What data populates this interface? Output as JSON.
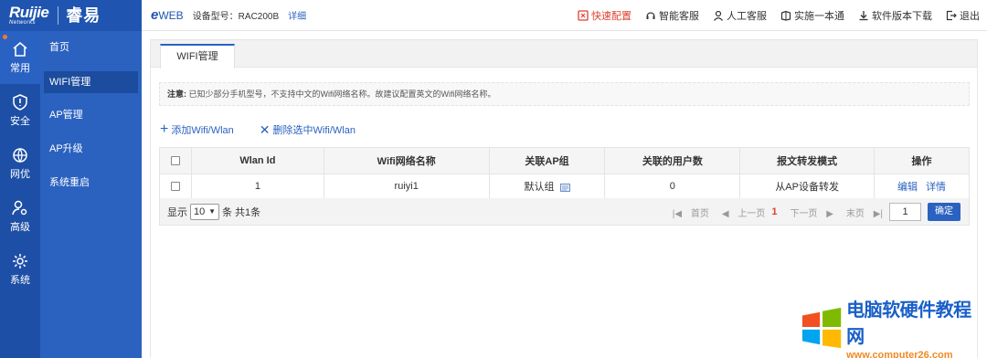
{
  "brand": {
    "logo_main": "Ruijie",
    "logo_sub": "Networks",
    "logo_cn": "睿易"
  },
  "topbar": {
    "eweb_e": "e",
    "eweb_text": "WEB",
    "model_label": "设备型号：RAC200B",
    "detail_link": "详细",
    "links": [
      "快速配置",
      "智能客服",
      "人工客服",
      "实施一本通",
      "软件版本下载",
      "退出"
    ]
  },
  "rail": [
    {
      "label": "常用",
      "icon": "home-icon"
    },
    {
      "label": "安全",
      "icon": "shield-icon"
    },
    {
      "label": "网优",
      "icon": "network-icon"
    },
    {
      "label": "高级",
      "icon": "user-gear-icon"
    },
    {
      "label": "系统",
      "icon": "gear-icon"
    }
  ],
  "submenu": [
    "首页",
    "WIFI管理",
    "AP管理",
    "AP升级",
    "系统重启"
  ],
  "tab": "WIFI管理",
  "notice": {
    "label": "注意:",
    "text": "已知少部分手机型号，不支持中文的Wifi网络名称。故建议配置英文的Wifi网络名称。"
  },
  "actions": {
    "add": "添加Wifi/Wlan",
    "delete": "删除选中Wifi/Wlan"
  },
  "table": {
    "headers": [
      "Wlan Id",
      "Wifi网络名称",
      "关联AP组",
      "关联的用户数",
      "报文转发模式",
      "操作"
    ],
    "rows": [
      {
        "wlan_id": "1",
        "name": "ruiyi1",
        "ap_group": "默认组",
        "users": "0",
        "mode": "从AP设备转发",
        "edit": "编辑",
        "detail": "详情"
      }
    ]
  },
  "pager": {
    "show_label": "显示",
    "page_size": "10",
    "summary": "条 共1条",
    "first": "首页",
    "prev": "上一页",
    "current": "1",
    "next": "下一页",
    "last": "末页",
    "input_value": "1",
    "ok": "确定"
  },
  "watermark": {
    "cn": "电脑软硬件教程网",
    "url": "www.computer26.com"
  }
}
